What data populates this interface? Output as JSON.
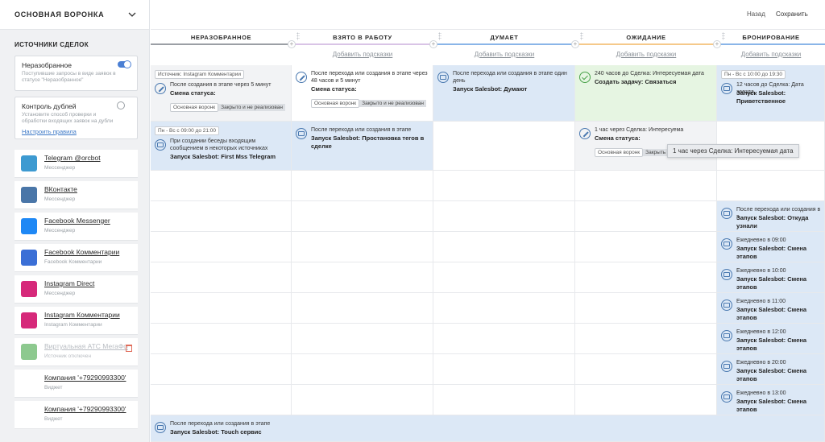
{
  "pipeline": {
    "title": "ОСНОВНАЯ ВОРОНКА"
  },
  "sidebar": {
    "section_title": "ИСТОЧНИКИ СДЕЛОК",
    "unsorted": {
      "title": "Неразобранное",
      "desc": "Поступившие запросы в виде заявок в статусе \"Неразобранное\"",
      "enabled": true
    },
    "dupes": {
      "title": "Контроль дублей",
      "desc": "Установите способ проверки и обработки входящих заявок на дубли",
      "link": "Настроить правила",
      "enabled": false
    },
    "sources": [
      {
        "name": "Telegram @orcbot",
        "sub": "Мессенджер",
        "icon": "telegram-icon",
        "color": "#3d9ad1"
      },
      {
        "name": "ВКонтакте",
        "sub": "Мессенджер",
        "icon": "vk-icon",
        "color": "#4a76a8"
      },
      {
        "name": "Facebook Messenger",
        "sub": "Мессенджер",
        "icon": "messenger-icon",
        "color": "#1e88f5"
      },
      {
        "name": "Facebook Комментарии",
        "sub": "Facebook Комментарии",
        "icon": "facebook-comments-icon",
        "color": "#3b6fd6"
      },
      {
        "name": "Instagram Direct",
        "sub": "Мессенджер",
        "icon": "instagram-icon",
        "color": "#d6297a"
      },
      {
        "name": "Instagram Комментарии",
        "sub": "Instagram Комментарии",
        "icon": "instagram-icon",
        "color": "#d6297a"
      },
      {
        "name": "Виртуальная АТС МегаФон",
        "sub": "Источник отключен",
        "icon": "megafon-icon",
        "color": "#8dc98f"
      },
      {
        "name": "Компания '+79290993300'",
        "sub": "Виджет",
        "icon": "broken-image-icon",
        "color": "#ffffff"
      },
      {
        "name": "Компания '+79290993300'",
        "sub": "Виджет",
        "icon": "broken-image-icon",
        "color": "#ffffff"
      }
    ]
  },
  "topbar": {
    "back": "Назад",
    "save": "Сохранить"
  },
  "add_hint": "Добавить подсказки",
  "columns": [
    {
      "title": "НЕРАЗОБРАННОЕ",
      "color": "#9b9fa5"
    },
    {
      "title": "ВЗЯТО В РАБОТУ",
      "color": "#d9c4e6"
    },
    {
      "title": "ДУМАЕТ",
      "color": "#8ab5e8"
    },
    {
      "title": "ОЖИДАНИЕ",
      "color": "#f5c98a"
    },
    {
      "title": "БРОНИРОВАНИЕ",
      "color": "#8ab5e8"
    }
  ],
  "cards": {
    "c1": {
      "tag": "Источник: Instagram Комментарии",
      "text": "После создания в этапе через 5 минут",
      "action": "Смена статуса:",
      "chip1": "Основная воронк",
      "chip2": "Закрыто и не реализован"
    },
    "c2": {
      "text": "После перехода или создания в этапе через 48 часов и 5 минут",
      "action": "Смена статуса:",
      "chip1": "Основная воронк",
      "chip2": "Закрыто и не реализован"
    },
    "c3": {
      "text": "После перехода или создания в этапе один день",
      "action": "Запуск Salesbot: Думают"
    },
    "c4": {
      "text": "240 часов до Сделка: Интересуемая дата",
      "action": "Создать задачу: Связаться"
    },
    "c5": {
      "tag": "Пн - Вс с 10:00 до 19:30",
      "text": "12 часов до Сделка: Дата заезда",
      "action": "Запуск Salesbot: Приветственное"
    },
    "c6": {
      "tag": "Пн - Вс с 09:00 до 21:00",
      "text": "При создании беседы входящим сообщением в некоторых источниках",
      "action": "Запуск Salesbot: First Mss Telegram"
    },
    "c7": {
      "text": "После перехода или создания в этапе",
      "action": "Запуск Salesbot: Простановка тегов в сделке"
    },
    "c8": {
      "text": "1 час через Сделка: Интересуема",
      "action": "Смена статуса:",
      "chip1": "Основная воронк",
      "chip2": "Закрыть"
    },
    "c9": {
      "text": "После перехода или создания в э",
      "action": "Запуск Salesbot: Откуда узнали"
    },
    "c10": {
      "text": "Ежедневно в 09:00",
      "action": "Запуск Salesbot: Смена этапов"
    },
    "c11": {
      "text": "Ежедневно в 10:00",
      "action": "Запуск Salesbot: Смена этапов"
    },
    "c12": {
      "text": "Ежедневно в 11:00",
      "action": "Запуск Salesbot: Смена этапов"
    },
    "c13": {
      "text": "Ежедневно в 12:00",
      "action": "Запуск Salesbot: Смена этапов"
    },
    "c14": {
      "text": "Ежедневно в 20:00",
      "action": "Запуск Salesbot: Смена этапов"
    },
    "c15": {
      "text": "Ежедневно в 13:00",
      "action": "Запуск Salesbot: Смена этапов"
    },
    "c16": {
      "text": "После перехода или создания в этапе",
      "action": "Запуск Salesbot: Touch сервис"
    }
  },
  "tooltip": "1 час через Сделка: Интересуемая дата"
}
